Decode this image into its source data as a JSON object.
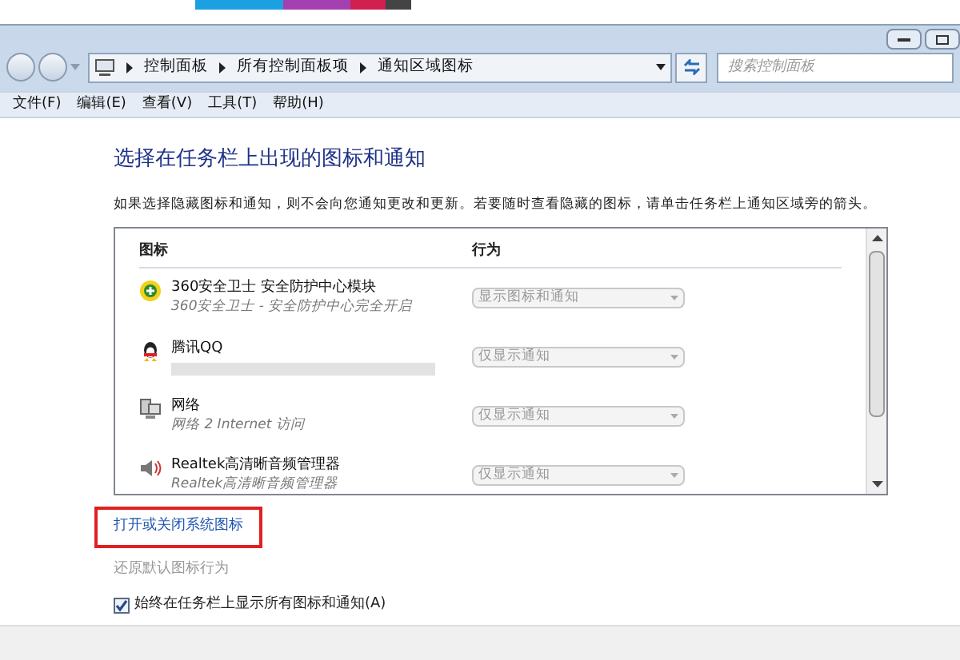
{
  "window": {
    "breadcrumbs": [
      "控制面板",
      "所有控制面板项",
      "通知区域图标"
    ],
    "search": {
      "placeholder": "搜索控制面板"
    }
  },
  "menu": [
    "文件(F)",
    "编辑(E)",
    "查看(V)",
    "工具(T)",
    "帮助(H)"
  ],
  "heading": "选择在任务栏上出现的图标和通知",
  "description": "如果选择隐藏图标和通知，则不会向您通知更改和更新。若要随时查看隐藏的图标，请单击任务栏上通知区域旁的箭头。",
  "table": {
    "columns": [
      "图标",
      "行为"
    ],
    "rows": [
      {
        "kind": "shield",
        "name": "360安全卫士 安全防护中心模块",
        "detail": "360安全卫士 - 安全防护中心完全开启",
        "behavior": "显示图标和通知",
        "disabled": true
      },
      {
        "kind": "penguin",
        "name": "腾讯QQ",
        "behavior": "仅显示通知",
        "disabled": true
      },
      {
        "kind": "network",
        "name": "网络",
        "detail": "网络 2 Internet 访问",
        "behavior": "仅显示通知",
        "disabled": true
      },
      {
        "kind": "speaker",
        "name": "Realtek高清晰音频管理器",
        "detail": "Realtek高清晰音频管理器",
        "behavior": "仅显示通知",
        "disabled": true
      }
    ]
  },
  "links": [
    {
      "label": "打开或关闭系统图标",
      "highlighted": true,
      "disabled": false
    },
    {
      "label": "还原默认图标行为",
      "highlighted": false,
      "disabled": true
    }
  ],
  "always_show": {
    "label": "始终在任务栏上显示所有图标和通知(A)",
    "checked": true
  }
}
